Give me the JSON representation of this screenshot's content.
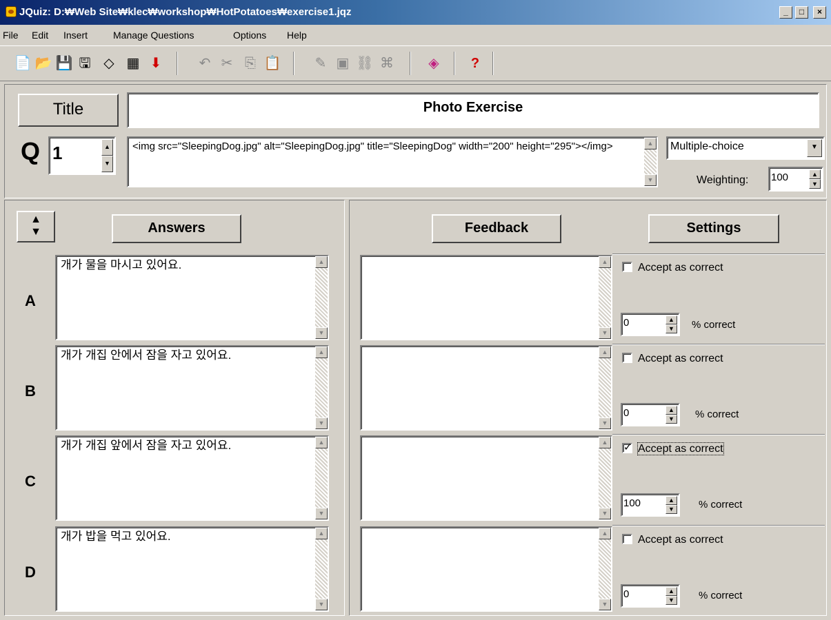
{
  "window": {
    "title": "JQuiz: D:₩Web Site₩klec₩workshop₩HotPotatoes₩exercise1.jqz",
    "min_label": "_",
    "max_label": "□",
    "close_label": "×"
  },
  "menu": [
    "File",
    "Edit",
    "Insert",
    "Manage Questions",
    "Options",
    "Help"
  ],
  "toolbar": {
    "icons": [
      "new-file-icon",
      "open-folder-icon",
      "save-icon",
      "save-as-icon",
      "eraser-icon",
      "web-page-icon",
      "export-arrow-icon",
      "undo-icon",
      "cut-icon",
      "copy-icon",
      "paste-icon",
      "add-text-icon",
      "add-picture-icon",
      "insert-link-icon",
      "network-icon",
      "config-icon",
      "help-icon"
    ]
  },
  "title_button_label": "Title",
  "exercise_title": "Photo Exercise",
  "question": {
    "label": "Q",
    "number": "1",
    "text": "<img src=\"SleepingDog.jpg\" alt=\"SleepingDog.jpg\" title=\"SleepingDog\" width=\"200\" height=\"295\"></img>",
    "type": "Multiple-choice",
    "weighting_label": "Weighting:",
    "weighting": "100"
  },
  "headers": {
    "answers": "Answers",
    "feedback": "Feedback",
    "settings": "Settings"
  },
  "answers": [
    {
      "letter": "A",
      "text": "개가 물을 마시고 있어요.",
      "feedback": "",
      "accept_label": "Accept as correct",
      "accepted": false,
      "percent": "0",
      "percent_label": "% correct"
    },
    {
      "letter": "B",
      "text": "개가 개집 안에서 잠을 자고 있어요.",
      "feedback": "",
      "accept_label": "Accept as correct",
      "accepted": false,
      "percent": "0",
      "percent_label": "% correct"
    },
    {
      "letter": "C",
      "text": "개가 개집 앞에서 잠을 자고 있어요.",
      "feedback": "",
      "accept_label": "Accept as correct",
      "accepted": true,
      "percent": "100",
      "percent_label": "% correct"
    },
    {
      "letter": "D",
      "text": "개가 밥을 먹고 있어요.",
      "feedback": "",
      "accept_label": "Accept as correct",
      "accepted": false,
      "percent": "0",
      "percent_label": "% correct"
    }
  ]
}
